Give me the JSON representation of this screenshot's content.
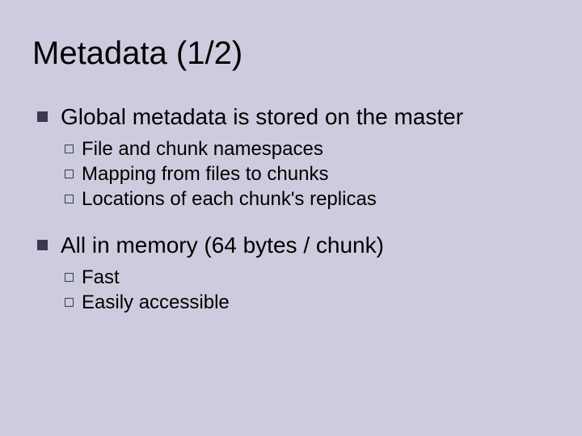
{
  "title": "Metadata (1/2)",
  "items": [
    {
      "text": "Global metadata is stored on the master",
      "sub": [
        "File and chunk namespaces",
        "Mapping from files to chunks",
        "Locations of each chunk's replicas"
      ]
    },
    {
      "text": "All in memory (64 bytes / chunk)",
      "sub": [
        "Fast",
        "Easily accessible"
      ]
    }
  ]
}
